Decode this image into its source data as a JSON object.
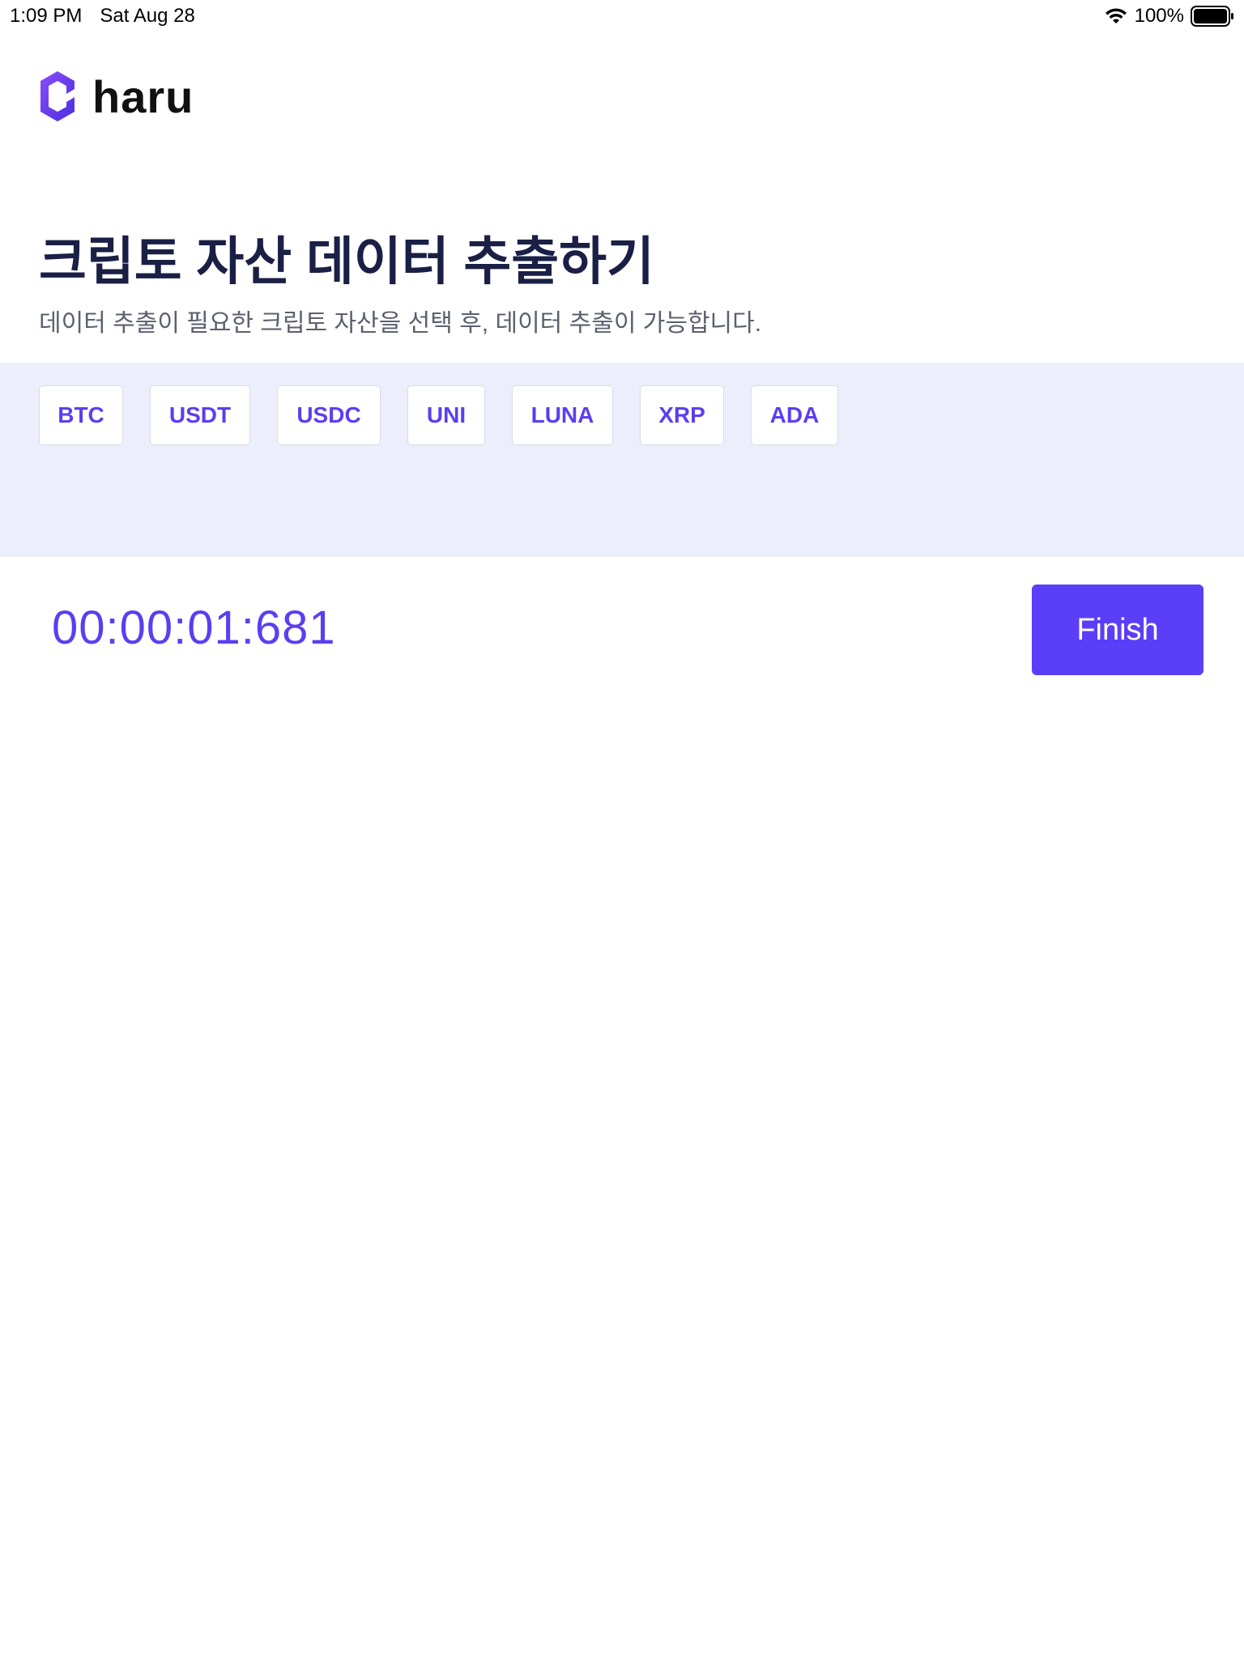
{
  "status_bar": {
    "time": "1:09 PM",
    "date": "Sat Aug 28",
    "battery": "100%",
    "icons": [
      "wifi-icon",
      "battery-icon"
    ]
  },
  "brand": {
    "name": "haru",
    "logo_icon": "hexagon-logo-icon",
    "logo_color": "#6a3df5"
  },
  "header": {
    "title": "크립토 자산 데이터 추출하기",
    "subtitle": "데이터 추출이 필요한 크립토 자산을 선택 후, 데이터 추출이 가능합니다."
  },
  "assets": [
    "BTC",
    "USDT",
    "USDC",
    "UNI",
    "LUNA",
    "XRP",
    "ADA"
  ],
  "timer": {
    "value": "00:00:01:681"
  },
  "actions": {
    "finish_label": "Finish"
  },
  "colors": {
    "accent": "#5b3ef8",
    "panel_bg": "#eceefb",
    "title": "#1a1f45"
  }
}
